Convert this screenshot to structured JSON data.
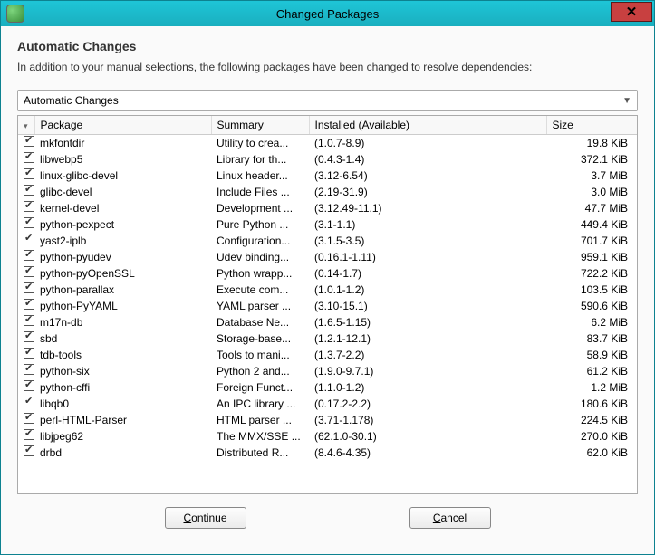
{
  "window": {
    "title": "Changed Packages"
  },
  "header": {
    "heading": "Automatic Changes",
    "subtext": "In addition to your manual selections, the following packages have been changed to resolve dependencies:"
  },
  "dropdown": {
    "label": "Automatic Changes"
  },
  "columns": {
    "package": "Package",
    "summary": "Summary",
    "installed": "Installed (Available)",
    "size": "Size"
  },
  "packages": [
    {
      "name": "mkfontdir",
      "summary": "Utility to crea...",
      "installed": "(1.0.7-8.9)",
      "size": "19.8 KiB"
    },
    {
      "name": "libwebp5",
      "summary": "Library for th...",
      "installed": "(0.4.3-1.4)",
      "size": "372.1 KiB"
    },
    {
      "name": "linux-glibc-devel",
      "summary": "Linux header...",
      "installed": "(3.12-6.54)",
      "size": "3.7 MiB"
    },
    {
      "name": "glibc-devel",
      "summary": "Include Files ...",
      "installed": "(2.19-31.9)",
      "size": "3.0 MiB"
    },
    {
      "name": "kernel-devel",
      "summary": "Development ...",
      "installed": "(3.12.49-11.1)",
      "size": "47.7 MiB"
    },
    {
      "name": "python-pexpect",
      "summary": "Pure Python ...",
      "installed": "(3.1-1.1)",
      "size": "449.4 KiB"
    },
    {
      "name": "yast2-iplb",
      "summary": "Configuration...",
      "installed": "(3.1.5-3.5)",
      "size": "701.7 KiB"
    },
    {
      "name": "python-pyudev",
      "summary": "Udev binding...",
      "installed": "(0.16.1-1.11)",
      "size": "959.1 KiB"
    },
    {
      "name": "python-pyOpenSSL",
      "summary": "Python wrapp...",
      "installed": "(0.14-1.7)",
      "size": "722.2 KiB"
    },
    {
      "name": "python-parallax",
      "summary": "Execute com...",
      "installed": "(1.0.1-1.2)",
      "size": "103.5 KiB"
    },
    {
      "name": "python-PyYAML",
      "summary": "YAML parser ...",
      "installed": "(3.10-15.1)",
      "size": "590.6 KiB"
    },
    {
      "name": "m17n-db",
      "summary": "Database Ne...",
      "installed": "(1.6.5-1.15)",
      "size": "6.2 MiB"
    },
    {
      "name": "sbd",
      "summary": "Storage-base...",
      "installed": "(1.2.1-12.1)",
      "size": "83.7 KiB"
    },
    {
      "name": "tdb-tools",
      "summary": "Tools to mani...",
      "installed": "(1.3.7-2.2)",
      "size": "58.9 KiB"
    },
    {
      "name": "python-six",
      "summary": "Python 2 and...",
      "installed": "(1.9.0-9.7.1)",
      "size": "61.2 KiB"
    },
    {
      "name": "python-cffi",
      "summary": "Foreign Funct...",
      "installed": "(1.1.0-1.2)",
      "size": "1.2 MiB"
    },
    {
      "name": "libqb0",
      "summary": "An IPC library ...",
      "installed": "(0.17.2-2.2)",
      "size": "180.6 KiB"
    },
    {
      "name": "perl-HTML-Parser",
      "summary": "HTML parser ...",
      "installed": "(3.71-1.178)",
      "size": "224.5 KiB"
    },
    {
      "name": "libjpeg62",
      "summary": "The MMX/SSE ...",
      "installed": "(62.1.0-30.1)",
      "size": "270.0 KiB"
    },
    {
      "name": "drbd",
      "summary": "Distributed R...",
      "installed": "(8.4.6-4.35)",
      "size": "62.0 KiB"
    }
  ],
  "buttons": {
    "continue": "Continue",
    "cancel": "Cancel"
  }
}
